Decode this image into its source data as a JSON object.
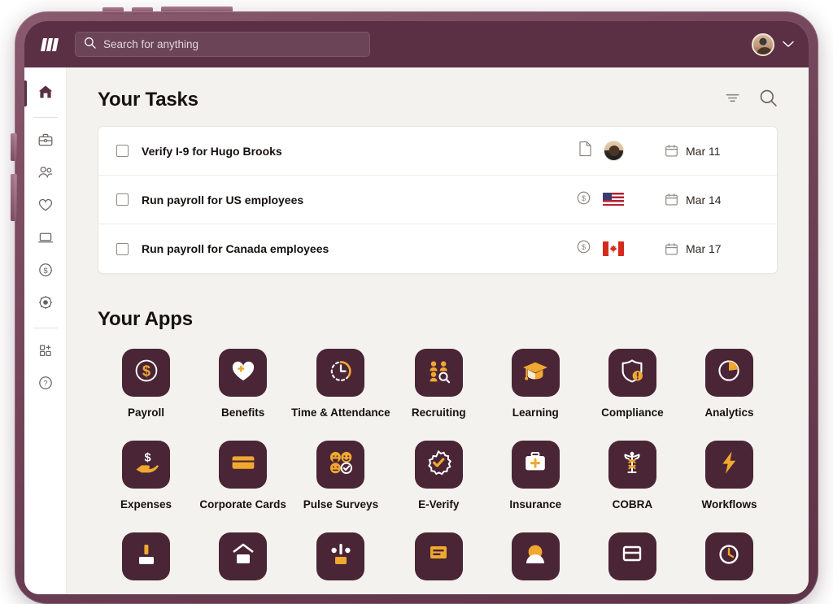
{
  "theme": {
    "bezel_color": "#6d4055",
    "topbar_color": "#5b2f44",
    "screen_bg": "#f4f2ee",
    "sidebar_bg": "#ffffff",
    "card_bg": "#ffffff",
    "app_tile_color": "#4a2535",
    "accent_gold": "#f0a830",
    "text_primary": "#15110f"
  },
  "topbar": {
    "logo_name": "rippling-logo",
    "search": {
      "placeholder": "Search for anything",
      "value": "",
      "icon": "search-icon"
    },
    "avatar_alt": "user-avatar",
    "chevron": "chevron-down-icon"
  },
  "sidebar": {
    "items": [
      {
        "name": "home",
        "icon": "home-icon",
        "active": true
      },
      {
        "name": "briefcase",
        "icon": "briefcase-icon",
        "active": false
      },
      {
        "name": "people",
        "icon": "people-icon",
        "active": false
      },
      {
        "name": "benefits",
        "icon": "heart-icon",
        "active": false
      },
      {
        "name": "devices",
        "icon": "laptop-icon",
        "active": false
      },
      {
        "name": "spend",
        "icon": "dollar-circle-icon",
        "active": false
      },
      {
        "name": "settings",
        "icon": "gear-icon",
        "active": false
      },
      {
        "name": "apps",
        "icon": "apps-grid-plus-icon",
        "active": false
      },
      {
        "name": "help",
        "icon": "question-circle-icon",
        "active": false
      }
    ]
  },
  "tasks": {
    "title": "Your Tasks",
    "filter_icon": "filter-icon",
    "search_icon": "search-icon",
    "rows": [
      {
        "label": "Verify I-9 for Hugo Brooks",
        "type_icon": "document-icon",
        "badge": "avatar",
        "date": "Mar 11",
        "date_icon": "calendar-icon",
        "checked": false
      },
      {
        "label": "Run payroll for US employees",
        "type_icon": "dollar-circle-icon",
        "badge": "flag-us",
        "date": "Mar 14",
        "date_icon": "calendar-icon",
        "checked": false
      },
      {
        "label": "Run payroll for Canada employees",
        "type_icon": "dollar-circle-icon",
        "badge": "flag-ca",
        "date": "Mar 17",
        "date_icon": "calendar-icon",
        "checked": false
      }
    ]
  },
  "apps": {
    "title": "Your Apps",
    "items": [
      {
        "label": "Payroll",
        "icon": "dollar-circle-icon"
      },
      {
        "label": "Benefits",
        "icon": "heart-plus-icon"
      },
      {
        "label": "Time & Attendance",
        "icon": "clock-dashed-icon"
      },
      {
        "label": "Recruiting",
        "icon": "people-search-icon"
      },
      {
        "label": "Learning",
        "icon": "graduation-cap-icon"
      },
      {
        "label": "Compliance",
        "icon": "shield-alert-icon"
      },
      {
        "label": "Analytics",
        "icon": "pie-chart-icon"
      },
      {
        "label": "Expenses",
        "icon": "hand-dollar-icon"
      },
      {
        "label": "Corporate Cards",
        "icon": "credit-card-icon"
      },
      {
        "label": "Pulse Surveys",
        "icon": "emoji-faces-icon"
      },
      {
        "label": "E-Verify",
        "icon": "badge-check-icon"
      },
      {
        "label": "Insurance",
        "icon": "first-aid-kit-icon"
      },
      {
        "label": "COBRA",
        "icon": "caduceus-icon"
      },
      {
        "label": "Workflows",
        "icon": "lightning-bolt-icon"
      }
    ],
    "partial_row": [
      {
        "label": "",
        "icon": "partial-tile-1"
      },
      {
        "label": "",
        "icon": "partial-tile-2"
      },
      {
        "label": "",
        "icon": "partial-tile-3"
      },
      {
        "label": "",
        "icon": "partial-tile-4"
      },
      {
        "label": "",
        "icon": "partial-tile-5"
      },
      {
        "label": "",
        "icon": "partial-tile-6"
      },
      {
        "label": "",
        "icon": "partial-tile-7"
      }
    ]
  }
}
